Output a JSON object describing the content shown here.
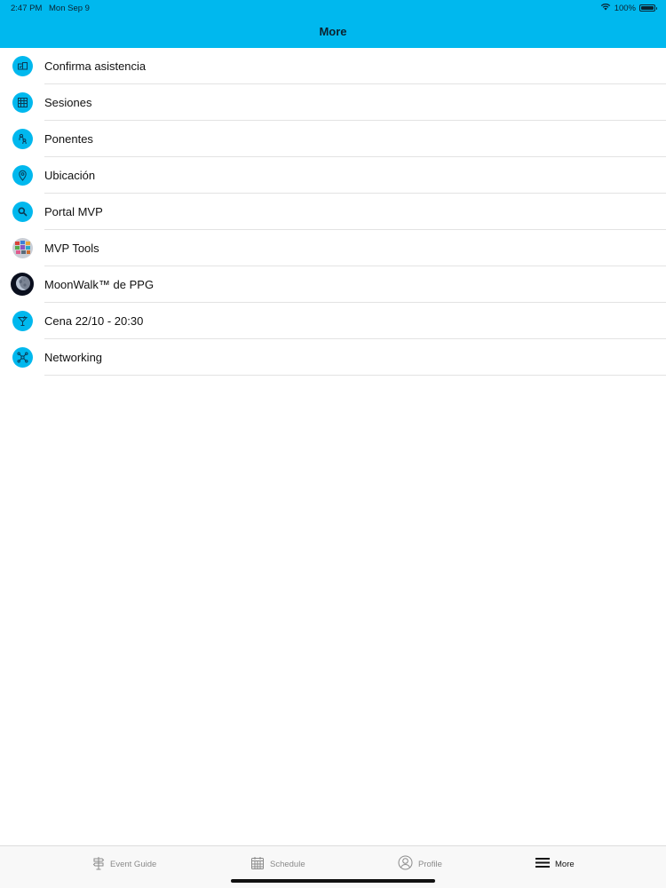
{
  "status_bar": {
    "time": "2:47 PM",
    "date": "Mon Sep 9",
    "battery_text": "100%",
    "battery_level": 1.0
  },
  "header": {
    "title": "More",
    "background_color": "#00b8ee"
  },
  "menu": {
    "items": [
      {
        "label": "Confirma asistencia",
        "icon": "rsvp-icon"
      },
      {
        "label": "Sesiones",
        "icon": "sessions-grid-icon"
      },
      {
        "label": "Ponentes",
        "icon": "speakers-icon"
      },
      {
        "label": "Ubicación",
        "icon": "location-pin-icon"
      },
      {
        "label": "Portal MVP",
        "icon": "search-icon"
      },
      {
        "label": "MVP Tools",
        "icon": "mvp-tools-icon"
      },
      {
        "label": "MoonWalk™ de PPG",
        "icon": "moon-icon"
      },
      {
        "label": "Cena 22/10 - 20:30",
        "icon": "cocktail-icon"
      },
      {
        "label": "Networking",
        "icon": "networking-icon"
      }
    ]
  },
  "tabbar": {
    "tabs": [
      {
        "label": "Event Guide",
        "icon": "signpost-icon",
        "active": false
      },
      {
        "label": "Schedule",
        "icon": "calendar-icon",
        "active": false
      },
      {
        "label": "Profile",
        "icon": "profile-icon",
        "active": false
      },
      {
        "label": "More",
        "icon": "hamburger-icon",
        "active": true
      }
    ]
  }
}
